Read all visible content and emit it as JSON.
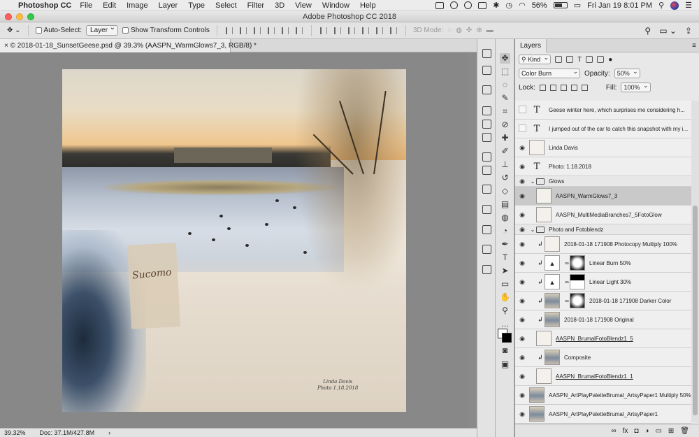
{
  "menubar": {
    "app": "Photoshop CC",
    "items": [
      "File",
      "Edit",
      "Image",
      "Layer",
      "Type",
      "Select",
      "Filter",
      "3D",
      "View",
      "Window",
      "Help"
    ],
    "battery": "56%",
    "clock": "Fri Jan 19  8:01 PM"
  },
  "window": {
    "title": "Adobe Photoshop CC 2018"
  },
  "options": {
    "auto_select_label": "Auto-Select:",
    "auto_select_value": "Layer",
    "show_transform_label": "Show Transform Controls",
    "mode_3d_label": "3D Mode:"
  },
  "document": {
    "tab_title": "© 2018-01-18_SunsetGeese.psd @ 39.3% (AASPN_WarmGlows7_3, RGB/8) *",
    "signature_name": "Linda Davis",
    "signature_date": "Photo 1.18.2018",
    "script_text": "Sucomo"
  },
  "status": {
    "zoom": "39.32%",
    "doc": "Doc: 37.1M/427.8M"
  },
  "layers_panel": {
    "tab": "Layers",
    "filter_kind": "Kind",
    "blend_mode": "Color Burn",
    "opacity_label": "Opacity:",
    "opacity_value": "50%",
    "lock_label": "Lock:",
    "fill_label": "Fill:",
    "fill_value": "100%",
    "layers": [
      {
        "name": "Geese winter here,      which surprises me considering h...",
        "kind": "text",
        "visible": false
      },
      {
        "name": "I jumped out of the car to catch this snapshot with my i...",
        "kind": "text",
        "visible": false
      },
      {
        "name": "Linda Davis",
        "kind": "pixel",
        "visible": true
      },
      {
        "name": "Photo: 1.18.2018",
        "kind": "text",
        "visible": true
      },
      {
        "name": "Glows",
        "kind": "group",
        "visible": true
      },
      {
        "name": "AASPN_WarmGlows7_3",
        "kind": "pixel",
        "visible": true,
        "selected": true
      },
      {
        "name": "AASPN_MultiMediaBranches7_5FotoGlow",
        "kind": "pixel",
        "visible": true
      },
      {
        "name": "Photo and Fotoblendz",
        "kind": "group",
        "visible": true
      },
      {
        "name": "2018-01-18 171908 Photocopy Multiply 100%",
        "kind": "clipped",
        "visible": true
      },
      {
        "name": "Linear Burn 50%",
        "kind": "adjust",
        "visible": true
      },
      {
        "name": "Linear Light 30%",
        "kind": "adjust",
        "visible": true
      },
      {
        "name": "2018-01-18 171908 Darker Color",
        "kind": "masked",
        "visible": true
      },
      {
        "name": "2018-01-18 171908 Original",
        "kind": "clipped",
        "visible": true
      },
      {
        "name": "AASPN_BrumalFotoBlendz1_5",
        "kind": "smart",
        "visible": true
      },
      {
        "name": "Composite",
        "kind": "clipped",
        "visible": true
      },
      {
        "name": "AASPN_BrumalFotoBlendz1_1",
        "kind": "smart",
        "visible": true
      },
      {
        "name": "AASPN_ArtPlayPaletteBrumal_ArtsyPaper1 Multiply 50%",
        "kind": "pixel",
        "visible": true
      },
      {
        "name": "AASPN_ArtPlayPaletteBrumal_ArtsyPaper1",
        "kind": "pixel",
        "visible": true
      }
    ]
  }
}
